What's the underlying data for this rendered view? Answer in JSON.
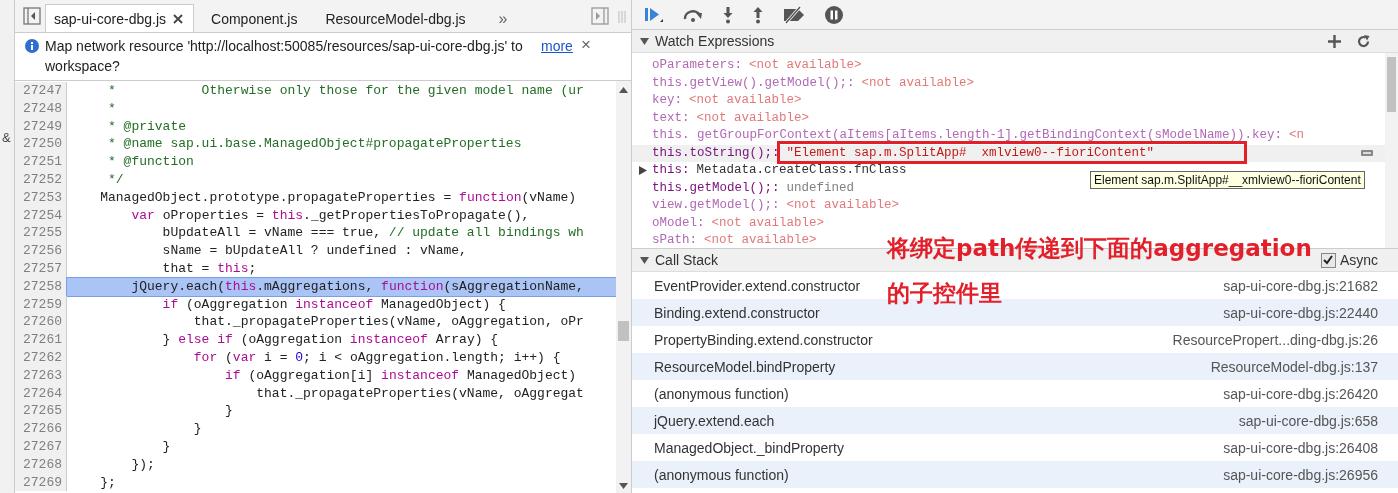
{
  "left_strip": {
    "text": "&"
  },
  "editor": {
    "tabs": [
      {
        "label": "sap-ui-core-dbg.js",
        "selected": true,
        "closable": true
      },
      {
        "label": "Component.js",
        "selected": false,
        "closable": false
      },
      {
        "label": "ResourceModel-dbg.js",
        "selected": false,
        "closable": false
      }
    ],
    "more_tabs": "»",
    "infobar": {
      "message": "Map network resource 'http://localhost:50085/resources/sap-ui-core-dbg.js' to workspace?",
      "link": "more",
      "close": "×"
    },
    "lines": [
      {
        "number": "27247",
        "selected": false,
        "tokens": [
          {
            "kind": "comment",
            "text": "     *           Otherwise only those for the given model name (ur"
          }
        ]
      },
      {
        "number": "27248",
        "selected": false,
        "tokens": [
          {
            "kind": "comment",
            "text": "     *"
          }
        ]
      },
      {
        "number": "27249",
        "selected": false,
        "tokens": [
          {
            "kind": "comment",
            "text": "     * @private"
          }
        ]
      },
      {
        "number": "27250",
        "selected": false,
        "tokens": [
          {
            "kind": "comment",
            "text": "     * @name sap.ui.base.ManagedObject#propagateProperties"
          }
        ]
      },
      {
        "number": "27251",
        "selected": false,
        "tokens": [
          {
            "kind": "comment",
            "text": "     * @function"
          }
        ]
      },
      {
        "number": "27252",
        "selected": false,
        "tokens": [
          {
            "kind": "comment",
            "text": "     */"
          }
        ]
      },
      {
        "number": "27253",
        "selected": false,
        "tokens": [
          {
            "kind": "plain",
            "text": "    ManagedObject.prototype.propagateProperties = "
          },
          {
            "kind": "keyword",
            "text": "function"
          },
          {
            "kind": "plain",
            "text": "(vName)"
          }
        ]
      },
      {
        "number": "27254",
        "selected": false,
        "tokens": [
          {
            "kind": "keyword",
            "text": "        var"
          },
          {
            "kind": "plain",
            "text": " oProperties = "
          },
          {
            "kind": "keyword",
            "text": "this"
          },
          {
            "kind": "plain",
            "text": "._getPropertiesToPropagate(),"
          }
        ]
      },
      {
        "number": "27255",
        "selected": false,
        "tokens": [
          {
            "kind": "plain",
            "text": "            bUpdateAll = vName === true, "
          },
          {
            "kind": "comment",
            "text": "// update all bindings wh"
          }
        ]
      },
      {
        "number": "27256",
        "selected": false,
        "tokens": [
          {
            "kind": "plain",
            "text": "            sName = bUpdateAll ? undefined : vName,"
          }
        ]
      },
      {
        "number": "27257",
        "selected": false,
        "tokens": [
          {
            "kind": "plain",
            "text": "            that = "
          },
          {
            "kind": "keyword",
            "text": "this"
          },
          {
            "kind": "plain",
            "text": ";"
          }
        ]
      },
      {
        "number": "27258",
        "selected": true,
        "tokens": [
          {
            "kind": "plain",
            "text": "        jQuery.each("
          },
          {
            "kind": "keyword",
            "text": "this"
          },
          {
            "kind": "plain",
            "text": ".mAggregations, "
          },
          {
            "kind": "keyword",
            "text": "function"
          },
          {
            "kind": "plain",
            "text": "(sAggregationName,"
          }
        ]
      },
      {
        "number": "27259",
        "selected": false,
        "tokens": [
          {
            "kind": "keyword",
            "text": "            if"
          },
          {
            "kind": "plain",
            "text": " (oAggregation "
          },
          {
            "kind": "keyword",
            "text": "instanceof"
          },
          {
            "kind": "plain",
            "text": " ManagedObject) {"
          }
        ]
      },
      {
        "number": "27260",
        "selected": false,
        "tokens": [
          {
            "kind": "plain",
            "text": "                that._propagateProperties(vName, oAggregation, oPr"
          }
        ]
      },
      {
        "number": "27261",
        "selected": false,
        "tokens": [
          {
            "kind": "plain",
            "text": "            } "
          },
          {
            "kind": "keyword",
            "text": "else if"
          },
          {
            "kind": "plain",
            "text": " (oAggregation "
          },
          {
            "kind": "keyword",
            "text": "instanceof"
          },
          {
            "kind": "plain",
            "text": " Array) {"
          }
        ]
      },
      {
        "number": "27262",
        "selected": false,
        "tokens": [
          {
            "kind": "keyword",
            "text": "                for"
          },
          {
            "kind": "plain",
            "text": " ("
          },
          {
            "kind": "keyword",
            "text": "var"
          },
          {
            "kind": "plain",
            "text": " i = "
          },
          {
            "kind": "number",
            "text": "0"
          },
          {
            "kind": "plain",
            "text": "; i < oAggregation.length; i++) {"
          }
        ]
      },
      {
        "number": "27263",
        "selected": false,
        "tokens": [
          {
            "kind": "keyword",
            "text": "                    if"
          },
          {
            "kind": "plain",
            "text": " (oAggregation[i] "
          },
          {
            "kind": "keyword",
            "text": "instanceof"
          },
          {
            "kind": "plain",
            "text": " ManagedObject)"
          }
        ]
      },
      {
        "number": "27264",
        "selected": false,
        "tokens": [
          {
            "kind": "plain",
            "text": "                        that._propagateProperties(vName, oAggregat"
          }
        ]
      },
      {
        "number": "27265",
        "selected": false,
        "tokens": [
          {
            "kind": "plain",
            "text": "                    }"
          }
        ]
      },
      {
        "number": "27266",
        "selected": false,
        "tokens": [
          {
            "kind": "plain",
            "text": "                }"
          }
        ]
      },
      {
        "number": "27267",
        "selected": false,
        "tokens": [
          {
            "kind": "plain",
            "text": "            }"
          }
        ]
      },
      {
        "number": "27268",
        "selected": false,
        "tokens": [
          {
            "kind": "plain",
            "text": "        });"
          }
        ]
      },
      {
        "number": "27269",
        "selected": false,
        "tokens": [
          {
            "kind": "plain",
            "text": "    };"
          }
        ]
      }
    ]
  },
  "watch": {
    "title": "Watch Expressions",
    "expanded": true,
    "items": [
      {
        "name": "oParameters:",
        "value": "<not available>",
        "kind": "unavailable",
        "selected": false,
        "expandable": false
      },
      {
        "name": "this.getView().getModel();:",
        "value": "<not available>",
        "kind": "unavailable",
        "selected": false,
        "expandable": false
      },
      {
        "name": "key:",
        "value": "<not available>",
        "kind": "unavailable",
        "selected": false,
        "expandable": false
      },
      {
        "name": "text:",
        "value": "<not available>",
        "kind": "unavailable",
        "selected": false,
        "expandable": false
      },
      {
        "name": "this. getGroupForContext(aItems[aItems.length-1].getBindingContext(sModelName)).key:",
        "value": "<n",
        "kind": "unavailable",
        "selected": false,
        "expandable": false
      },
      {
        "name": "this.toString();:",
        "value": "\"Element sap.m.SplitApp#  xmlview0--fioriContent\"",
        "kind": "string",
        "selected": true,
        "expandable": false
      },
      {
        "name": "this:",
        "value": "Metadata.createClass.fnClass",
        "kind": "object",
        "selected": false,
        "expandable": true
      },
      {
        "name": "this.getModel();:",
        "value": "undefined",
        "kind": "undefined",
        "selected": false,
        "expandable": false
      },
      {
        "name": "view.getModel();:",
        "value": "<not available>",
        "kind": "unavailable",
        "selected": false,
        "expandable": false
      },
      {
        "name": "oModel:",
        "value": "<not available>",
        "kind": "unavailable",
        "selected": false,
        "expandable": false
      },
      {
        "name": "sPath:",
        "value": "<not available>",
        "kind": "unavailable",
        "selected": false,
        "expandable": false
      }
    ],
    "tooltip": "Element sap.m.SplitApp#__xmlview0--fioriContent"
  },
  "call_stack": {
    "title": "Call Stack",
    "expanded": true,
    "async": {
      "label": "Async",
      "checked": true
    },
    "frames": [
      {
        "function": "EventProvider.extend.constructor",
        "location": "sap-ui-core-dbg.js:21682"
      },
      {
        "function": "Binding.extend.constructor",
        "location": "sap-ui-core-dbg.js:22440"
      },
      {
        "function": "PropertyBinding.extend.constructor",
        "location": "ResourcePropert...ding-dbg.js:26"
      },
      {
        "function": "ResourceModel.bindProperty",
        "location": "ResourceModel-dbg.js:137"
      },
      {
        "function": "(anonymous function)",
        "location": "sap-ui-core-dbg.js:26420"
      },
      {
        "function": "jQuery.extend.each",
        "location": "sap-ui-core-dbg.js:658"
      },
      {
        "function": "ManagedObject._bindProperty",
        "location": "sap-ui-core-dbg.js:26408"
      },
      {
        "function": "(anonymous function)",
        "location": "sap-ui-core-dbg.js:26956"
      }
    ]
  },
  "annotation": {
    "lines": [
      "将绑定path传递到下面的aggregation",
      "的子控件里"
    ]
  }
}
